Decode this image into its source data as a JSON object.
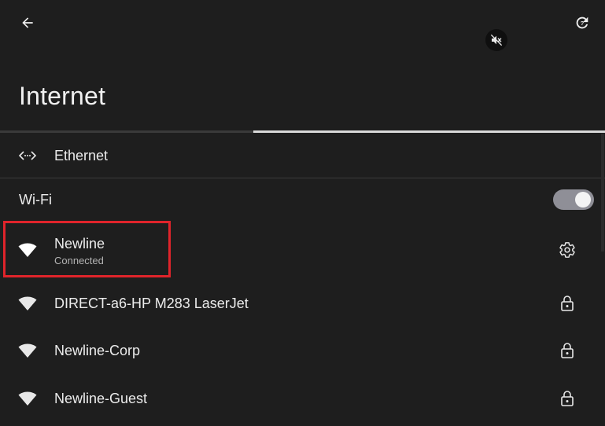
{
  "toolbar": {
    "back_icon": "arrow-left-icon",
    "help_icon": "refresh-help-icon",
    "mute_icon": "volume-off-icon"
  },
  "page": {
    "title": "Internet"
  },
  "ethernet": {
    "icon": "ethernet-icon",
    "label": "Ethernet"
  },
  "wifi": {
    "label": "Wi-Fi",
    "enabled": true
  },
  "networks": [
    {
      "name": "Newline",
      "status": "Connected",
      "icon": "wifi-icon",
      "trailing_icon": "gear-icon",
      "highlighted": true
    },
    {
      "name": "DIRECT-a6-HP M283 LaserJet",
      "status": "",
      "icon": "wifi-icon",
      "trailing_icon": "lock-icon"
    },
    {
      "name": "Newline-Corp",
      "status": "",
      "icon": "wifi-icon",
      "trailing_icon": "lock-icon"
    },
    {
      "name": "Newline-Guest",
      "status": "",
      "icon": "wifi-icon",
      "trailing_icon": "lock-icon"
    }
  ],
  "colors": {
    "background": "#1e1e1e",
    "highlight": "#e0242b",
    "toggle_track": "#8f8f97"
  }
}
